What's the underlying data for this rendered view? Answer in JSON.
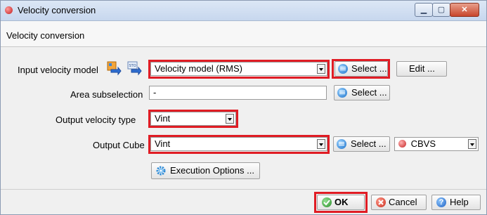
{
  "window": {
    "title": "Velocity conversion"
  },
  "header": {
    "title": "Velocity conversion"
  },
  "input": {
    "label": "Input velocity model",
    "value": "Velocity model (RMS)",
    "select_label": "Select ...",
    "edit_label": "Edit ..."
  },
  "area": {
    "label": "Area subselection",
    "value": "-",
    "select_label": "Select ..."
  },
  "output_type": {
    "label": "Output velocity type",
    "value": "Vint"
  },
  "output_cube": {
    "label": "Output Cube",
    "value": "Vint",
    "select_label": "Select ...",
    "storage_value": "CBVS"
  },
  "execution": {
    "label": "Execution Options ..."
  },
  "footer": {
    "ok_label": "OK",
    "cancel_label": "Cancel",
    "help_label": "Help"
  },
  "colors": {
    "highlight": "#e01c24",
    "accent": "#1d72c9",
    "ok": "#3aa23a",
    "cancel": "#d93a2b"
  }
}
